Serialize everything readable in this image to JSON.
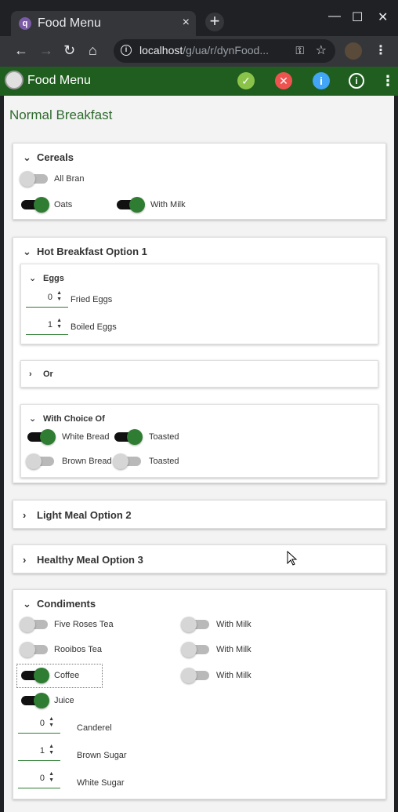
{
  "browser": {
    "tab_title": "Food Menu",
    "tab_favicon": "q",
    "tab_close": "×",
    "new_tab": "+",
    "url_host": "localhost",
    "url_path": "/g/ua/r/dynFood...",
    "min": "—",
    "max": "☐",
    "close": "✕"
  },
  "app": {
    "title": "Food Menu",
    "page_title": "Normal Breakfast"
  },
  "sections": {
    "cereals": {
      "title": "Cereals",
      "all_bran": "All Bran",
      "oats": "Oats",
      "with_milk": "With Milk"
    },
    "hot": {
      "title": "Hot Breakfast Option 1",
      "eggs": {
        "title": "Eggs",
        "fried_value": "0",
        "fried_label": "Fried Eggs",
        "boiled_value": "1",
        "boiled_label": "Boiled Eggs"
      },
      "or": {
        "title": "Or"
      },
      "choice": {
        "title": "With Choice Of",
        "white_bread": "White Bread",
        "toasted1": "Toasted",
        "brown_bread": "Brown Bread",
        "toasted2": "Toasted"
      }
    },
    "light": {
      "title": "Light Meal Option 2"
    },
    "healthy": {
      "title": "Healthy Meal Option 3"
    },
    "condiments": {
      "title": "Condiments",
      "five_roses": "Five Roses Tea",
      "rooibos": "Rooibos Tea",
      "coffee": "Coffee",
      "juice": "Juice",
      "with_milk1": "With Milk",
      "with_milk2": "With Milk",
      "with_milk3": "With Milk",
      "canderel_value": "0",
      "canderel": "Canderel",
      "brown_sugar_value": "1",
      "brown_sugar": "Brown Sugar",
      "white_sugar_value": "0",
      "white_sugar": "White Sugar"
    }
  },
  "colors": {
    "appbar": "#1f5e1f",
    "toggle_on": "#2e7d32",
    "page_title": "#2e6b2e"
  }
}
